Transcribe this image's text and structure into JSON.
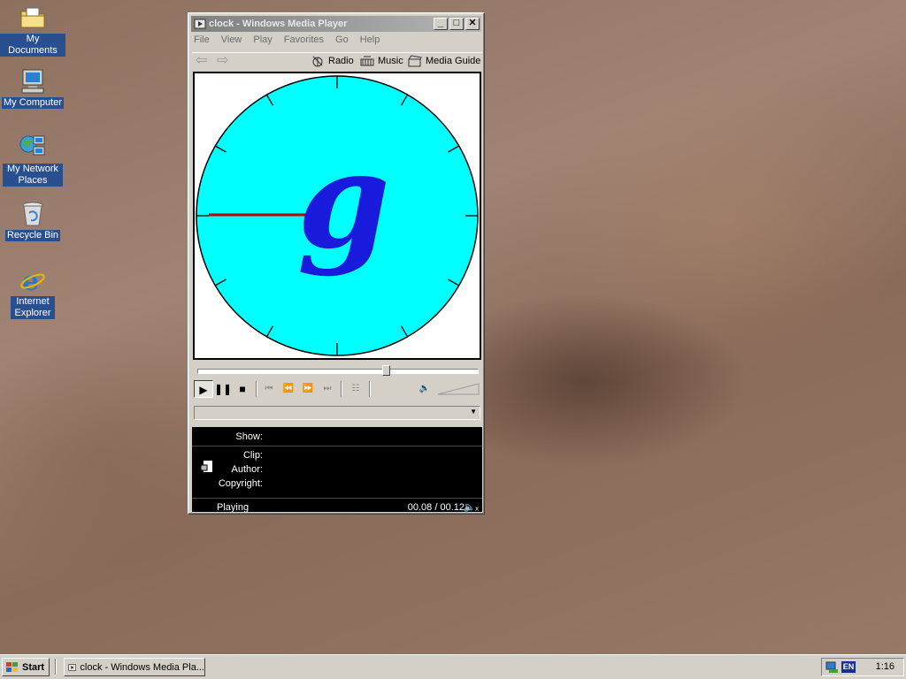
{
  "desktop": {
    "icons": [
      {
        "label": "My Documents",
        "icon": "folder-documents-icon"
      },
      {
        "label": "My Computer",
        "icon": "computer-icon"
      },
      {
        "label": "My Network Places",
        "icon": "network-places-icon"
      },
      {
        "label": "Recycle Bin",
        "icon": "recycle-bin-icon"
      },
      {
        "label": "Internet Explorer",
        "icon": "internet-explorer-icon"
      }
    ]
  },
  "window": {
    "title": "clock - Windows Media Player",
    "menu": [
      "File",
      "View",
      "Play",
      "Favorites",
      "Go",
      "Help"
    ],
    "nav_links": [
      "Radio",
      "Music",
      "Media Guide"
    ],
    "video": {
      "face_color": "#00ffff",
      "logo_text": "g",
      "logo_color": "#1a1adc",
      "hand_color": "#c00000"
    },
    "seek_position": 0.67,
    "info": {
      "show_label": "Show:",
      "show_value": "",
      "clip_label": "Clip:",
      "author_label": "Author:",
      "copyright_label": "Copyright:",
      "status": "Playing",
      "time": "00.08 / 00.12"
    }
  },
  "taskbar": {
    "start_label": "Start",
    "task_label": "clock - Windows Media Pla...",
    "language": "EN",
    "clock": "1:16"
  }
}
